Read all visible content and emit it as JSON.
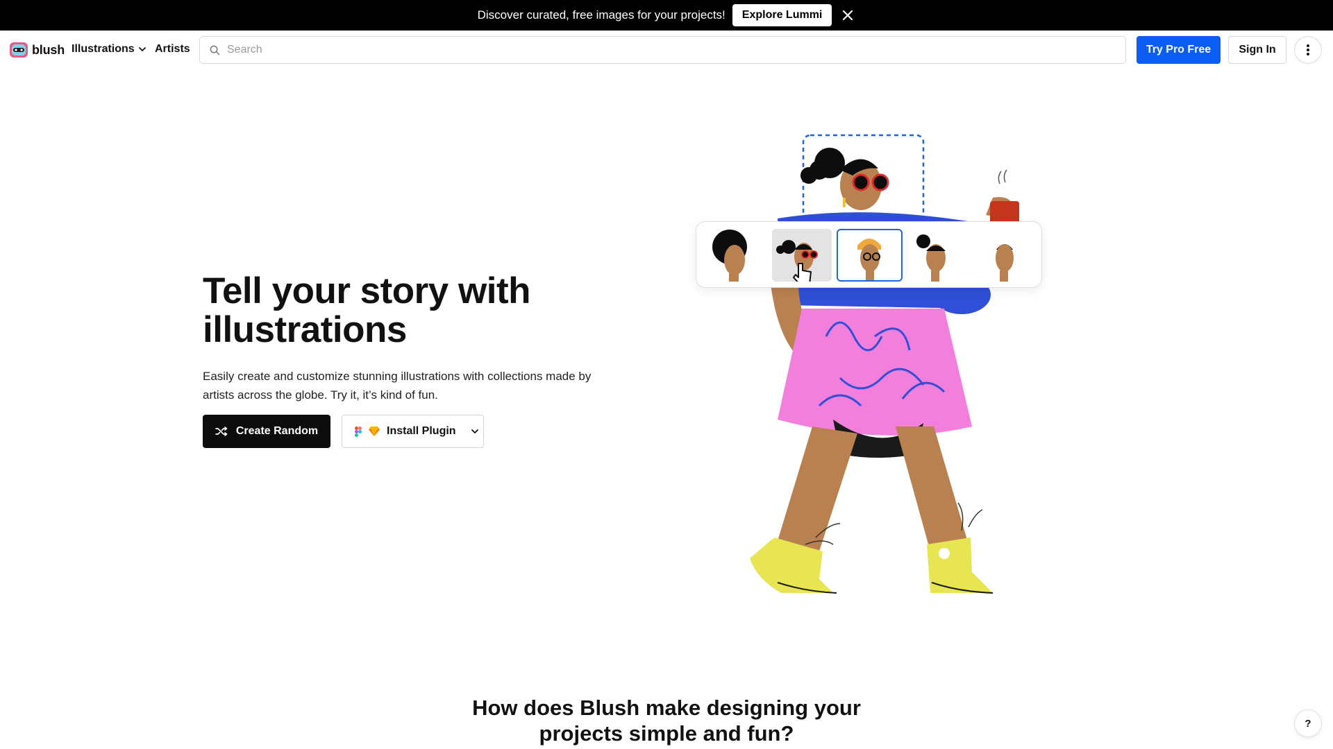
{
  "announcement": {
    "message": "Discover curated, free images for your projects!",
    "cta_label": "Explore Lummi",
    "close_icon": "close-icon"
  },
  "nav": {
    "logo_text": "blush",
    "illustrations_label": "Illustrations",
    "artists_label": "Artists",
    "search_placeholder": "Search",
    "search_value": "",
    "pro_label": "Try Pro Free",
    "signin_label": "Sign In",
    "more_icon": "more-vertical-icon"
  },
  "hero": {
    "title": "Tell your story with illustrations",
    "subtitle": "Easily create and customize stunning illustrations with collections made by artists across the globe. Try it, it’s kind of fun.",
    "random_label": "Create Random",
    "plugin_label": "Install Plugin"
  },
  "section": {
    "title": "How does Blush make designing your projects simple and fun?"
  },
  "help_label": "?",
  "colors": {
    "accent": "#0a5cf5",
    "dark": "#0d0d0d",
    "skin": "#b8814f",
    "shirt": "#2f4fd6",
    "skirt": "#f27fdc",
    "shoes": "#e7e551"
  }
}
